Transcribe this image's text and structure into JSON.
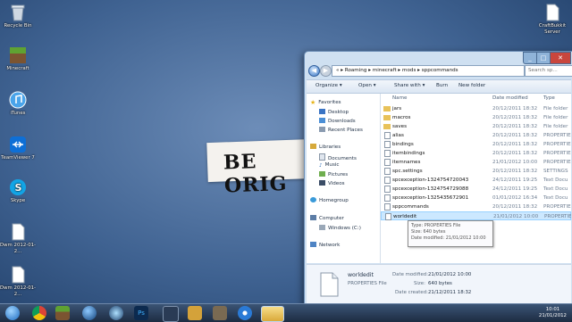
{
  "desktop": {
    "icons": [
      {
        "label": "Recycle Bin",
        "icon": "recycle-bin-icon"
      },
      {
        "label": "Minecraft",
        "icon": "minecraft-icon"
      },
      {
        "label": "iTunes",
        "icon": "itunes-icon"
      },
      {
        "label": "TeamViewer 7",
        "icon": "teamviewer-icon"
      },
      {
        "label": "Skype",
        "icon": "skype-icon"
      },
      {
        "label": "Dwm 2012-01-2...",
        "icon": "document-icon"
      },
      {
        "label": "Dwm 2012-01-2...",
        "icon": "document-icon"
      },
      {
        "label": "CraftBukkit Server",
        "icon": "document-icon"
      }
    ],
    "wallpaper_text": "BE ORIG"
  },
  "explorer": {
    "breadcrumb": [
      "«",
      "Roaming",
      "minecraft",
      "mods",
      "sppcommands"
    ],
    "search_placeholder": "Search sp...",
    "toolbar": {
      "organize": "Organize ▾",
      "open": "Open ▾",
      "share": "Share with ▾",
      "burn": "Burn",
      "new_folder": "New folder"
    },
    "nav": {
      "favorites": "Favorites",
      "desktop": "Desktop",
      "downloads": "Downloads",
      "recent": "Recent Places",
      "libraries": "Libraries",
      "documents": "Documents",
      "music": "Music",
      "pictures": "Pictures",
      "videos": "Videos",
      "homegroup": "Homegroup",
      "computer": "Computer",
      "windows_c": "Windows (C:)",
      "network": "Network"
    },
    "columns": {
      "name": "Name",
      "date": "Date modified",
      "type": "Type"
    },
    "files": [
      {
        "name": "jars",
        "date": "20/12/2011 18:32",
        "type": "File folder",
        "kind": "folder"
      },
      {
        "name": "macros",
        "date": "20/12/2011 18:32",
        "type": "File folder",
        "kind": "folder"
      },
      {
        "name": "saves",
        "date": "20/12/2011 18:32",
        "type": "File folder",
        "kind": "folder"
      },
      {
        "name": "alias",
        "date": "20/12/2011 18:32",
        "type": "PROPERTIES",
        "kind": "file"
      },
      {
        "name": "bindings",
        "date": "20/12/2011 18:32",
        "type": "PROPERTIES",
        "kind": "file"
      },
      {
        "name": "itembindings",
        "date": "20/12/2011 18:32",
        "type": "PROPERTIES",
        "kind": "file"
      },
      {
        "name": "itemnames",
        "date": "21/01/2012 10:00",
        "type": "PROPERTIES",
        "kind": "file"
      },
      {
        "name": "spc.settings",
        "date": "20/12/2011 18:32",
        "type": "SETTINGS",
        "kind": "file"
      },
      {
        "name": "spcexception-1324754720043",
        "date": "24/12/2011 19:25",
        "type": "Text Docu",
        "kind": "text"
      },
      {
        "name": "spcexception-1324754729088",
        "date": "24/12/2011 19:25",
        "type": "Text Docu",
        "kind": "text"
      },
      {
        "name": "spcexception-1325435672901",
        "date": "01/01/2012 16:34",
        "type": "Text Docu",
        "kind": "text"
      },
      {
        "name": "sppcommands",
        "date": "20/12/2011 18:32",
        "type": "PROPERTIES",
        "kind": "file"
      },
      {
        "name": "worldedit",
        "date": "21/01/2012 10:00",
        "type": "PROPERTIES",
        "kind": "file",
        "selected": true
      }
    ],
    "tooltip": {
      "type": "Type: PROPERTIES File",
      "size": "Size: 640 bytes",
      "modified": "Date modified: 21/01/2012 10:00"
    },
    "details": {
      "name": "worldedit",
      "kind": "PROPERTIES File",
      "modified_label": "Date modified:",
      "modified": "21/01/2012 10:00",
      "size_label": "Size:",
      "size": "640 bytes",
      "created_label": "Date created:",
      "created": "21/12/2011 18:32"
    }
  },
  "taskbar": {
    "time": "10:01",
    "date": "21/01/2012"
  },
  "colors": {
    "selection": "#cce8ff",
    "folder": "#e8c25a",
    "taskbar": "#1d2c42"
  }
}
